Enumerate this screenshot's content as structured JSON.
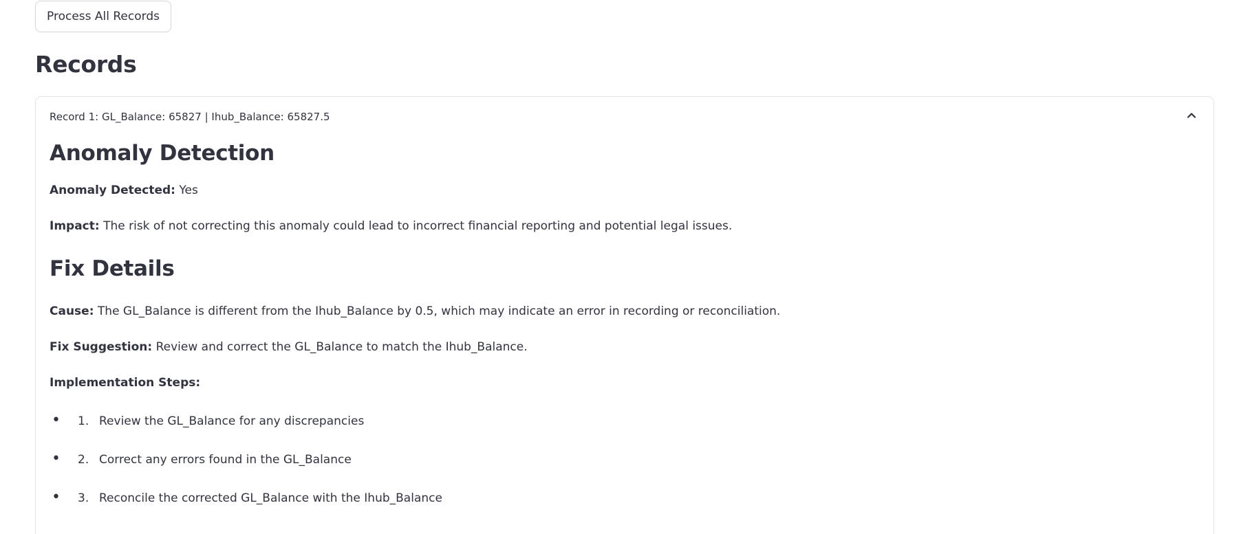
{
  "toolbar": {
    "process_label": "Process All Records"
  },
  "records": {
    "heading": "Records",
    "items": [
      {
        "header": "Record 1: GL_Balance: 65827 | Ihub_Balance: 65827.5",
        "expanded": true,
        "anomaly": {
          "heading": "Anomaly Detection",
          "detected_label": "Anomaly Detected:",
          "detected_value": "Yes",
          "impact_label": "Impact:",
          "impact_value": "The risk of not correcting this anomaly could lead to incorrect financial reporting and potential legal issues."
        },
        "fix": {
          "heading": "Fix Details",
          "cause_label": "Cause:",
          "cause_value": "The GL_Balance is different from the Ihub_Balance by 0.5, which may indicate an error in recording or reconciliation.",
          "suggestion_label": "Fix Suggestion:",
          "suggestion_value": "Review and correct the GL_Balance to match the Ihub_Balance.",
          "steps_label": "Implementation Steps:",
          "steps": [
            {
              "num": "1.",
              "text": "Review the GL_Balance for any discrepancies"
            },
            {
              "num": "2.",
              "text": "Correct any errors found in the GL_Balance"
            },
            {
              "num": "3.",
              "text": "Reconcile the corrected GL_Balance with the Ihub_Balance"
            }
          ]
        }
      }
    ]
  },
  "icons": {
    "collapse": "chevron-up-icon",
    "bullet": "disc-bullet"
  },
  "colors": {
    "text": "#31333f",
    "border": "#e3e4e8",
    "button_border": "#d6d7dc"
  }
}
